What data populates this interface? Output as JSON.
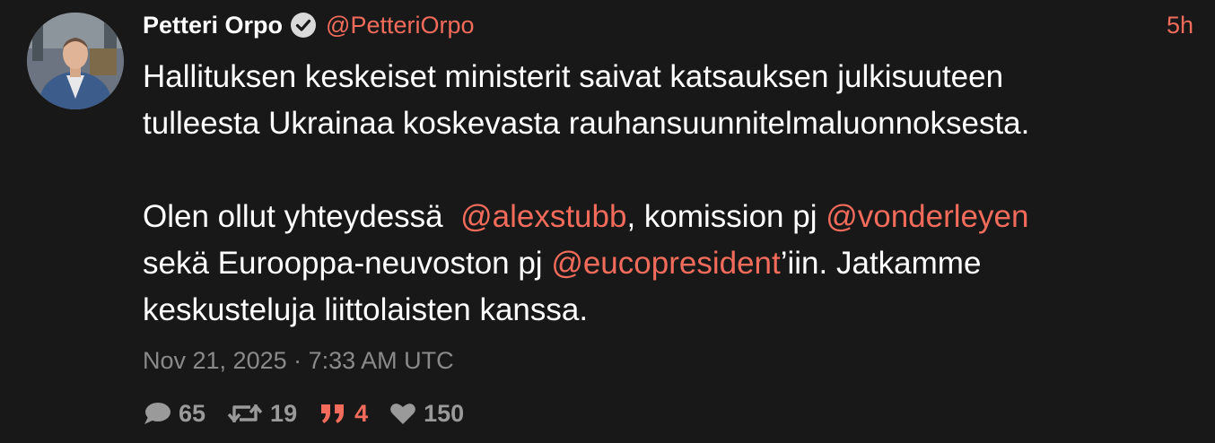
{
  "author": {
    "display_name": "Petteri Orpo",
    "handle": "@PetteriOrpo",
    "verified_icon": "verified-check-icon",
    "avatar": "profile-photo"
  },
  "time_ago": "5h",
  "tweet": {
    "line1": "Hallituksen keskeiset ministerit saivat katsauksen julkisuuteen",
    "line2": "tulleesta Ukrainaa koskevasta rauhansuunnitelmaluonnoksesta.",
    "p2_a": "Olen ollut yhteydessä  ",
    "mention1": "@alexstubb",
    "p2_b": ", komission pj ",
    "mention2": "@vonderleyen",
    "p2_c": "sekä Eurooppa-neuvoston pj ",
    "mention3": "@eucopresident",
    "p2_d": "’iin. Jatkamme",
    "p2_e": "keskusteluja liittolaisten kanssa."
  },
  "date": "Nov 21, 2025 · 7:33 AM UTC",
  "stats": {
    "replies": "65",
    "retweets": "19",
    "quotes": "4",
    "likes": "150"
  },
  "colors": {
    "background": "#181818",
    "accent": "#f26b5b",
    "muted": "#8a8a8a"
  }
}
